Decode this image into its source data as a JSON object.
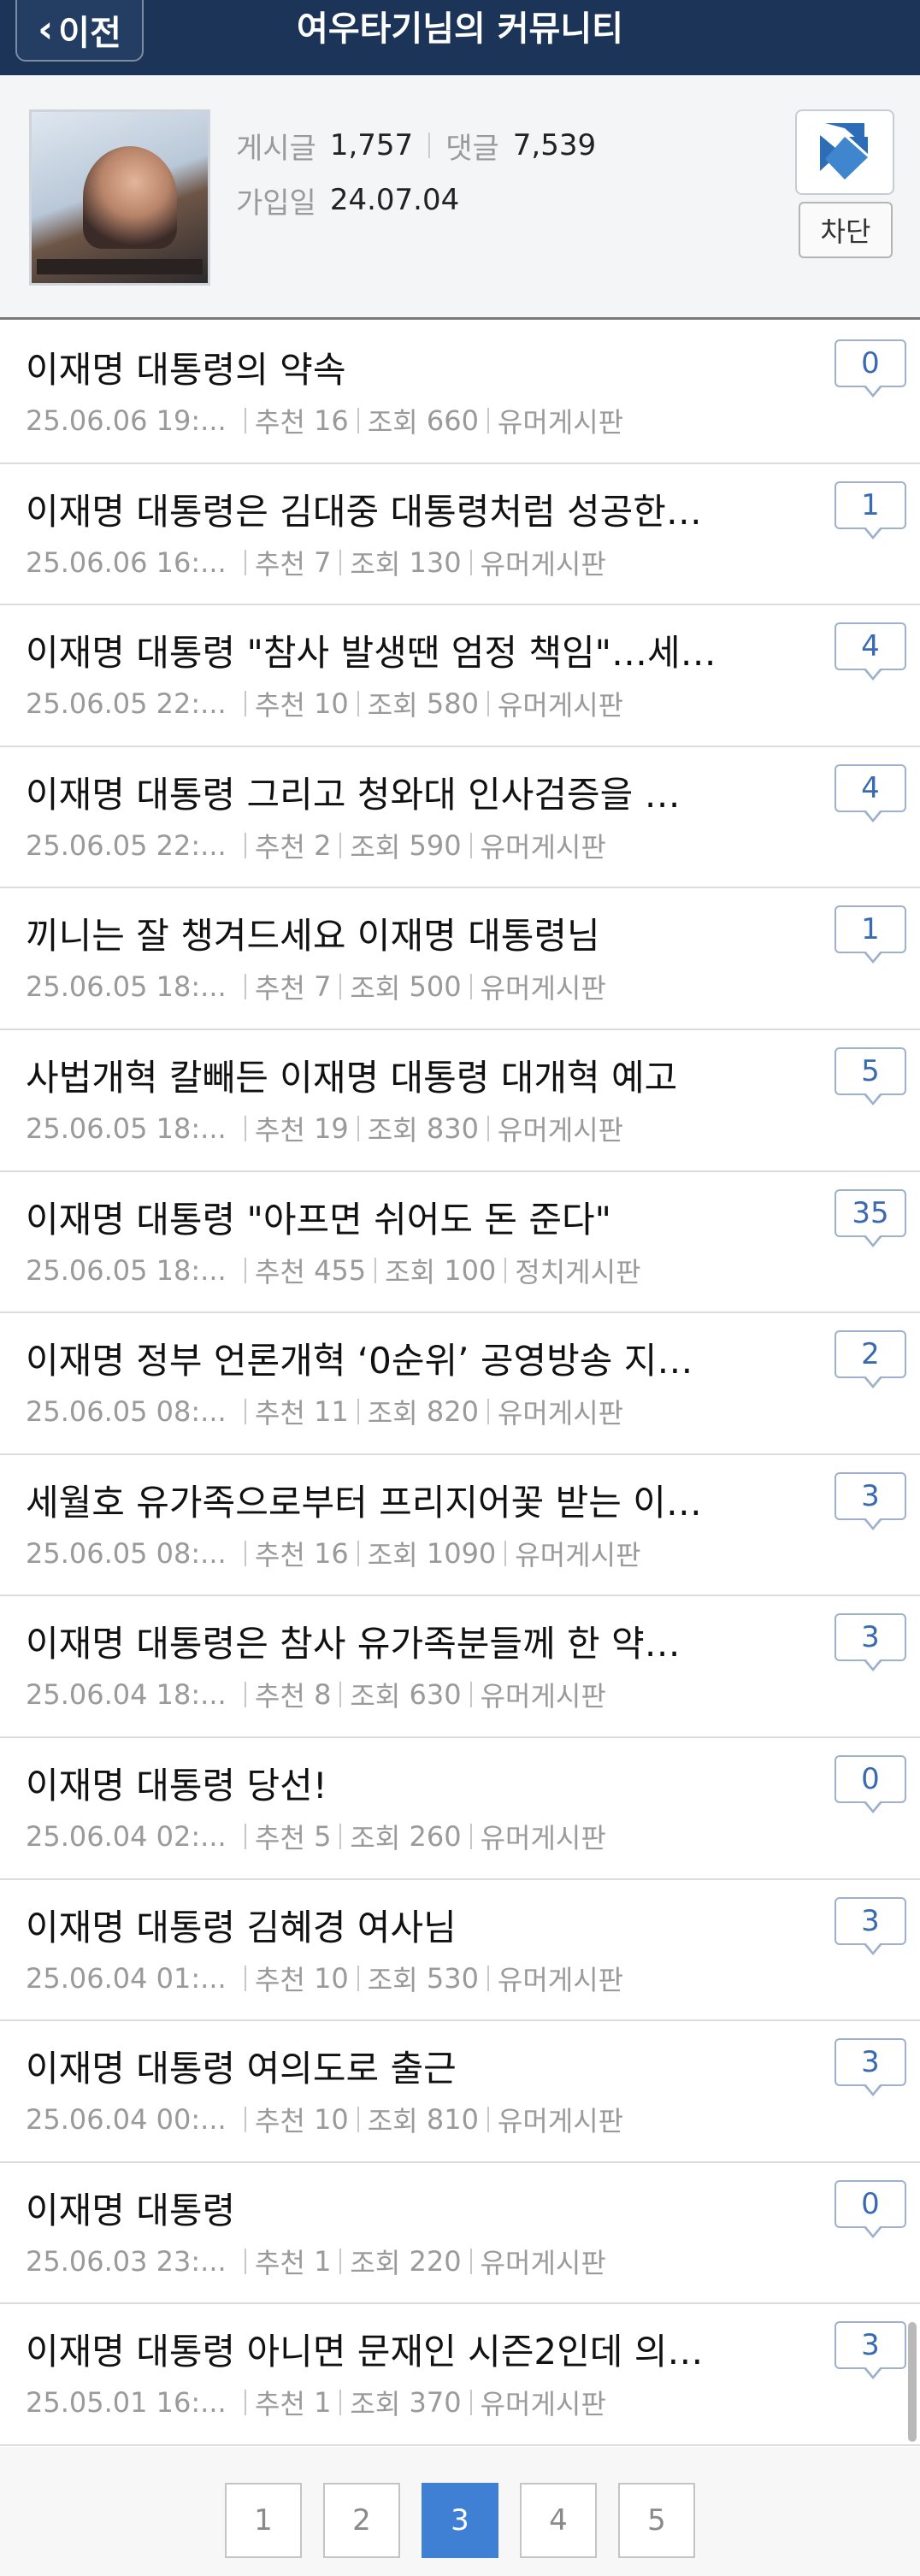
{
  "header": {
    "back_label": "이전",
    "title": "여우타기님의 커뮤니티"
  },
  "profile": {
    "posts_label": "게시글",
    "posts_count": "1,757",
    "comments_label": "댓글",
    "comments_count": "7,539",
    "joined_label": "가입일",
    "joined_date": "24.07.04",
    "block_label": "차단",
    "avatar_icon": "profile-photo",
    "logo_icon": "community-logo-icon"
  },
  "colors": {
    "header_bg": "#1c3458",
    "active_page": "#3f7fd4",
    "comment_count": "#3a6bb0"
  },
  "meta_labels": {
    "recommend": "추천",
    "views": "조회"
  },
  "posts": [
    {
      "title": "이재명 대통령의 약속",
      "date": "25.06.06 19:...",
      "recommend": "16",
      "views": "660",
      "board": "유머게시판",
      "comments": "0"
    },
    {
      "title": "이재명 대통령은 김대중 대통령처럼 성공한…",
      "date": "25.06.06 16:...",
      "recommend": "7",
      "views": "130",
      "board": "유머게시판",
      "comments": "1"
    },
    {
      "title": "이재명 대통령 \"참사 발생땐 엄정 책임\"…세…",
      "date": "25.06.05 22:...",
      "recommend": "10",
      "views": "580",
      "board": "유머게시판",
      "comments": "4"
    },
    {
      "title": "이재명 대통령 그리고 청와대 인사검증을 …",
      "date": "25.06.05 22:...",
      "recommend": "2",
      "views": "590",
      "board": "유머게시판",
      "comments": "4"
    },
    {
      "title": "끼니는 잘 챙겨드세요 이재명 대통령님",
      "date": "25.06.05 18:...",
      "recommend": "7",
      "views": "500",
      "board": "유머게시판",
      "comments": "1"
    },
    {
      "title": "사법개혁 칼빼든 이재명 대통령 대개혁 예고",
      "date": "25.06.05 18:...",
      "recommend": "19",
      "views": "830",
      "board": "유머게시판",
      "comments": "5"
    },
    {
      "title": "이재명 대통령 \"아프면 쉬어도 돈 준다\"",
      "date": "25.06.05 18:...",
      "recommend": "455",
      "views": "100",
      "board": "정치게시판",
      "comments": "35"
    },
    {
      "title": "이재명 정부 언론개혁 ‘0순위’ 공영방송 지…",
      "date": "25.06.05 08:...",
      "recommend": "11",
      "views": "820",
      "board": "유머게시판",
      "comments": "2"
    },
    {
      "title": "세월호 유가족으로부터 프리지어꽃 받는 이…",
      "date": "25.06.05 08:...",
      "recommend": "16",
      "views": "1090",
      "board": "유머게시판",
      "comments": "3"
    },
    {
      "title": "이재명 대통령은 참사 유가족분들께 한 약…",
      "date": "25.06.04 18:...",
      "recommend": "8",
      "views": "630",
      "board": "유머게시판",
      "comments": "3"
    },
    {
      "title": "이재명 대통령 당선!",
      "date": "25.06.04 02:...",
      "recommend": "5",
      "views": "260",
      "board": "유머게시판",
      "comments": "0"
    },
    {
      "title": "이재명 대통령 김혜경 여사님",
      "date": "25.06.04 01:...",
      "recommend": "10",
      "views": "530",
      "board": "유머게시판",
      "comments": "3"
    },
    {
      "title": "이재명 대통령 여의도로 출근",
      "date": "25.06.04 00:...",
      "recommend": "10",
      "views": "810",
      "board": "유머게시판",
      "comments": "3"
    },
    {
      "title": "이재명 대통령",
      "date": "25.06.03 23:...",
      "recommend": "1",
      "views": "220",
      "board": "유머게시판",
      "comments": "0"
    },
    {
      "title": "이재명 대통령 아니면 문재인 시즌2인데 의…",
      "date": "25.05.01 16:...",
      "recommend": "1",
      "views": "370",
      "board": "유머게시판",
      "comments": "3"
    }
  ],
  "pagination": {
    "pages": [
      "1",
      "2",
      "3",
      "4",
      "5"
    ],
    "current": "3"
  }
}
